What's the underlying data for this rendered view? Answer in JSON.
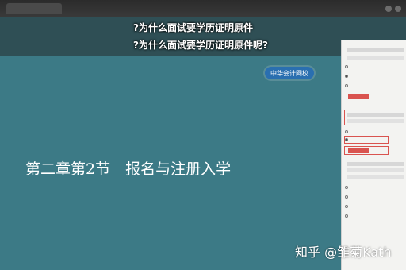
{
  "overlay": {
    "title_line1": "?为什么面试要学历证明原件",
    "title_line2": "?为什么面试要学历证明原件呢?"
  },
  "slide": {
    "logo_text": "中华会计网校",
    "heading": "第二章第2节　报名与注册入学"
  },
  "watermark": "知乎 @雏菊Kath"
}
